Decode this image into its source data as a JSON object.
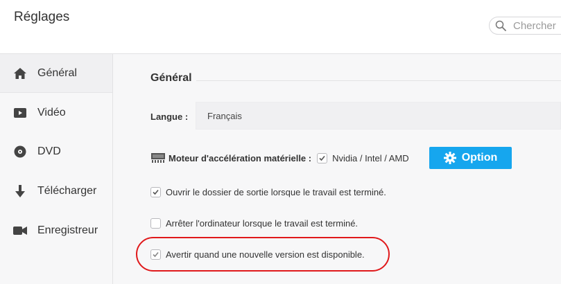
{
  "header": {
    "title": "Réglages"
  },
  "search": {
    "placeholder": "Chercher"
  },
  "sidebar": {
    "items": [
      {
        "label": "Général",
        "icon": "home-icon",
        "active": true
      },
      {
        "label": "Vidéo",
        "icon": "video-icon"
      },
      {
        "label": "DVD",
        "icon": "disc-icon"
      },
      {
        "label": "Télécharger",
        "icon": "download-icon"
      },
      {
        "label": "Enregistreur",
        "icon": "camera-icon"
      }
    ]
  },
  "main": {
    "section_title": "Général",
    "language": {
      "label": "Langue :",
      "value": "Français"
    },
    "hw_accel": {
      "label": "Moteur d'accélération matérielle :",
      "checkbox_label": "Nvidia / Intel / AMD",
      "checked": true,
      "button_label": "Option"
    },
    "options": [
      {
        "label": "Ouvrir le dossier de sortie lorsque le travail est terminé.",
        "checked": true
      },
      {
        "label": "Arrêter l'ordinateur lorsque le travail est terminé.",
        "checked": false
      },
      {
        "label": "Avertir quand une nouvelle version est disponible.",
        "checked": true,
        "highlighted": true
      }
    ]
  },
  "colors": {
    "accent": "#16a6ee",
    "highlight": "#e0191b"
  }
}
